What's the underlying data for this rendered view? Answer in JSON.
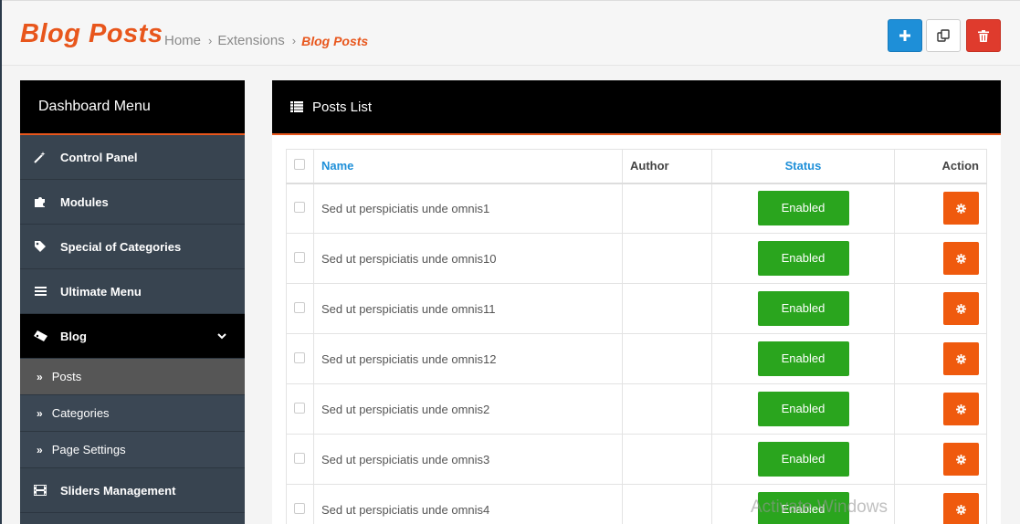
{
  "header": {
    "title": "Blog Posts",
    "breadcrumb": [
      {
        "label": "Home"
      },
      {
        "label": "Extensions"
      },
      {
        "label": "Blog Posts"
      }
    ],
    "separator": "›",
    "buttons": {
      "add_icon": "plus-icon",
      "copy_icon": "copy-icon",
      "delete_icon": "trash-icon"
    }
  },
  "sidebar": {
    "title": "Dashboard Menu",
    "items": [
      {
        "label": "Control Panel",
        "icon": "magic-wand-icon"
      },
      {
        "label": "Modules",
        "icon": "puzzle-icon"
      },
      {
        "label": "Special of Categories",
        "icon": "tag-icon"
      },
      {
        "label": "Ultimate Menu",
        "icon": "menu-icon"
      },
      {
        "label": "Blog",
        "icon": "ticket-icon"
      }
    ],
    "blog_sub": [
      {
        "label": "Posts"
      },
      {
        "label": "Categories"
      },
      {
        "label": "Page Settings"
      }
    ],
    "sliders": {
      "label": "Sliders Management",
      "icon": "film-icon"
    },
    "sub_arrow": "»"
  },
  "panel": {
    "title": "Posts List",
    "columns": {
      "name": "Name",
      "author": "Author",
      "status": "Status",
      "action": "Action"
    },
    "rows": [
      {
        "name": "Sed ut perspiciatis unde omnis1",
        "author": "",
        "status": "Enabled"
      },
      {
        "name": "Sed ut perspiciatis unde omnis10",
        "author": "",
        "status": "Enabled"
      },
      {
        "name": "Sed ut perspiciatis unde omnis11",
        "author": "",
        "status": "Enabled"
      },
      {
        "name": "Sed ut perspiciatis unde omnis12",
        "author": "",
        "status": "Enabled"
      },
      {
        "name": "Sed ut perspiciatis unde omnis2",
        "author": "",
        "status": "Enabled"
      },
      {
        "name": "Sed ut perspiciatis unde omnis3",
        "author": "",
        "status": "Enabled"
      },
      {
        "name": "Sed ut perspiciatis unde omnis4",
        "author": "",
        "status": "Enabled"
      }
    ]
  },
  "watermark": "Activate Windows",
  "colors": {
    "accent": "#e8561c",
    "primary": "#1e8fd8",
    "danger": "#df3b2d",
    "success": "#2aa51e",
    "action": "#ef5a0e"
  }
}
